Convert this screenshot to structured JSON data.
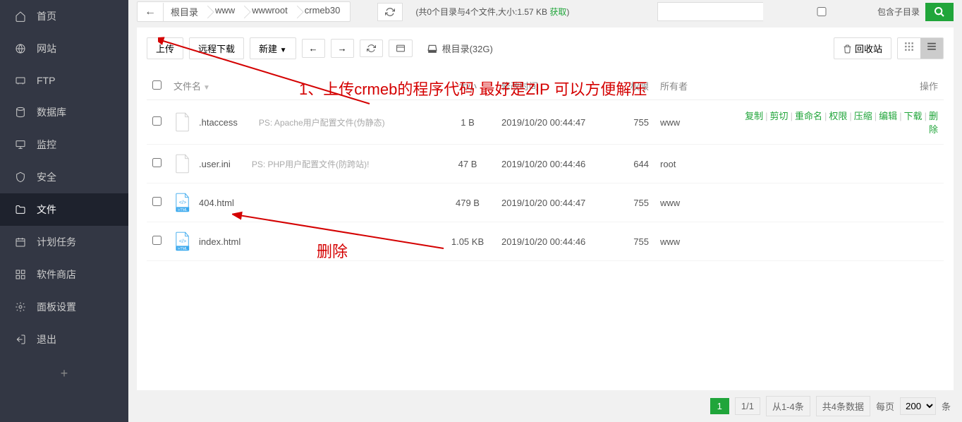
{
  "sidebar": {
    "items": [
      {
        "label": "首页",
        "icon": "home-icon"
      },
      {
        "label": "网站",
        "icon": "globe-icon"
      },
      {
        "label": "FTP",
        "icon": "ftp-icon"
      },
      {
        "label": "数据库",
        "icon": "database-icon"
      },
      {
        "label": "监控",
        "icon": "monitor-icon"
      },
      {
        "label": "安全",
        "icon": "shield-icon"
      },
      {
        "label": "文件",
        "icon": "folder-icon",
        "active": true
      },
      {
        "label": "计划任务",
        "icon": "calendar-icon"
      },
      {
        "label": "软件商店",
        "icon": "apps-icon"
      },
      {
        "label": "面板设置",
        "icon": "gear-icon"
      },
      {
        "label": "退出",
        "icon": "logout-icon"
      }
    ]
  },
  "breadcrumb": [
    "根目录",
    "www",
    "wwwroot",
    "crmeb30"
  ],
  "summary": {
    "prefix": "(共0个目录与4个文件,大小:1.57 KB ",
    "get": "获取",
    "suffix": ")"
  },
  "search": {
    "placeholder": "",
    "subdir_label": "包含子目录"
  },
  "toolbar": {
    "upload": "上传",
    "remote": "远程下载",
    "new": "新建",
    "recycle": "回收站"
  },
  "disk": {
    "label": "根目录(32G)"
  },
  "table": {
    "headers": {
      "name": "文件名",
      "size": "大小",
      "mtime": "修改时间",
      "perm": "权限",
      "owner": "所有者",
      "action": "操作"
    },
    "rows": [
      {
        "name": ".htaccess",
        "desc": "PS: Apache用户配置文件(伪静态)",
        "type": "file",
        "size": "1 B",
        "mtime": "2019/10/20 00:44:47",
        "perm": "755",
        "owner": "www",
        "show_actions": true
      },
      {
        "name": ".user.ini",
        "desc": "PS: PHP用户配置文件(防跨站)!",
        "type": "file",
        "size": "47 B",
        "mtime": "2019/10/20 00:44:46",
        "perm": "644",
        "owner": "root",
        "show_actions": false
      },
      {
        "name": "404.html",
        "desc": "",
        "type": "html",
        "size": "479 B",
        "mtime": "2019/10/20 00:44:47",
        "perm": "755",
        "owner": "www",
        "show_actions": false
      },
      {
        "name": "index.html",
        "desc": "",
        "type": "html",
        "size": "1.05 KB",
        "mtime": "2019/10/20 00:44:46",
        "perm": "755",
        "owner": "www",
        "show_actions": false
      }
    ],
    "actions": [
      "复制",
      "剪切",
      "重命名",
      "权限",
      "压缩",
      "编辑",
      "下载",
      "删除"
    ]
  },
  "pagination": {
    "current": "1",
    "total": "1/1",
    "range": "从1-4条",
    "count": "共4条数据",
    "perpage_label": "每页",
    "perpage": "200",
    "unit": "条"
  },
  "annotations": [
    {
      "text": "1、上传crmeb的程序代码 最好是ZIP 可以方便解压"
    },
    {
      "text": "删除"
    }
  ]
}
